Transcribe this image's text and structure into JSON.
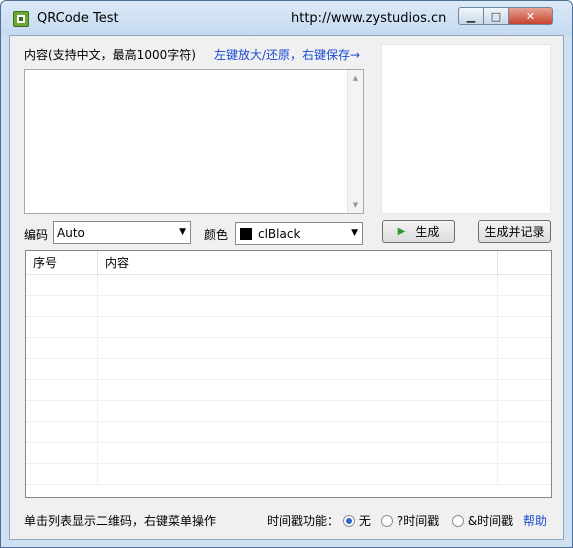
{
  "window": {
    "title": "QRCode Test",
    "url": "http://www.zystudios.cn",
    "minimize_glyph": "▁",
    "maximize_glyph": "□",
    "close_glyph": "✕"
  },
  "content": {
    "label": "内容(支持中文，最高1000字符)",
    "hint": "左键放大/还原，右键保存→",
    "text_value": ""
  },
  "encoding": {
    "label": "编码",
    "selected": "Auto"
  },
  "color": {
    "label": "颜色",
    "selected": "clBlack",
    "swatch": "#000000"
  },
  "buttons": {
    "generate": "生成",
    "generate_record": "生成并记录"
  },
  "list": {
    "columns": [
      "序号",
      "内容"
    ],
    "rows": []
  },
  "status": {
    "hint": "单击列表显示二维码，右键菜单操作",
    "timestamp_label": "时间戳功能：",
    "options": [
      {
        "label": "无",
        "checked": true
      },
      {
        "label": "?时间戳",
        "checked": false
      },
      {
        "label": "&时间戳",
        "checked": false
      }
    ],
    "help": "帮助"
  },
  "colors": {
    "link": "#1a4bd6",
    "play": "#2d9a2d"
  },
  "icons": {
    "app": "qrcode-icon",
    "play": "play-icon",
    "dropdown": "chevron-down-icon"
  }
}
